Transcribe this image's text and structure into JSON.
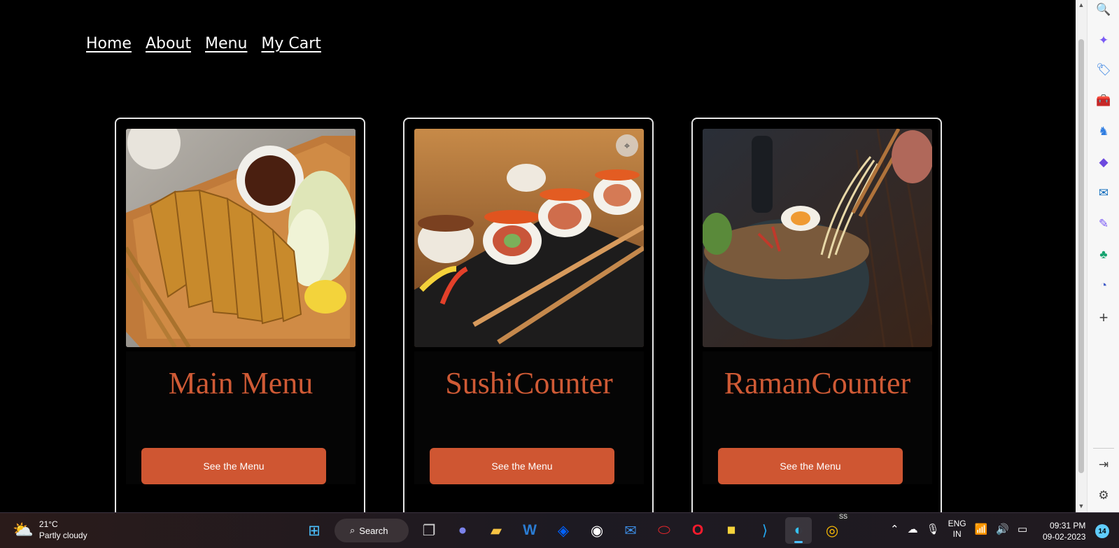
{
  "nav": {
    "items": [
      "Home",
      "About",
      "Menu",
      "My Cart"
    ]
  },
  "cards": [
    {
      "title": "Main Menu",
      "button": "See the Menu",
      "image": "tonkatsu-photo"
    },
    {
      "title": "SushiCounter",
      "button": "See the Menu",
      "image": "sushi-photo"
    },
    {
      "title": "RamanCounter",
      "button": "See the Menu",
      "image": "ramen-photo"
    }
  ],
  "colors": {
    "accent": "#cf5632",
    "title": "#cf5a35",
    "background": "#000000"
  },
  "edge_sidebar": {
    "icons": [
      "search-icon",
      "copilot-icon",
      "shopping-tag-icon",
      "toolbox-icon",
      "games-icon",
      "office-icon",
      "outlook-icon",
      "designer-icon",
      "tree-icon",
      "drop-icon",
      "add-icon",
      "sidebar-toggle-icon",
      "settings-icon"
    ]
  },
  "taskbar": {
    "weather_temp": "21°C",
    "weather_desc": "Partly cloudy",
    "search_label": "Search",
    "language_line1": "ENG",
    "language_line2": "IN",
    "time": "09:31 PM",
    "date": "09-02-2023",
    "notifications": "14",
    "chrome_badge": "SS"
  }
}
